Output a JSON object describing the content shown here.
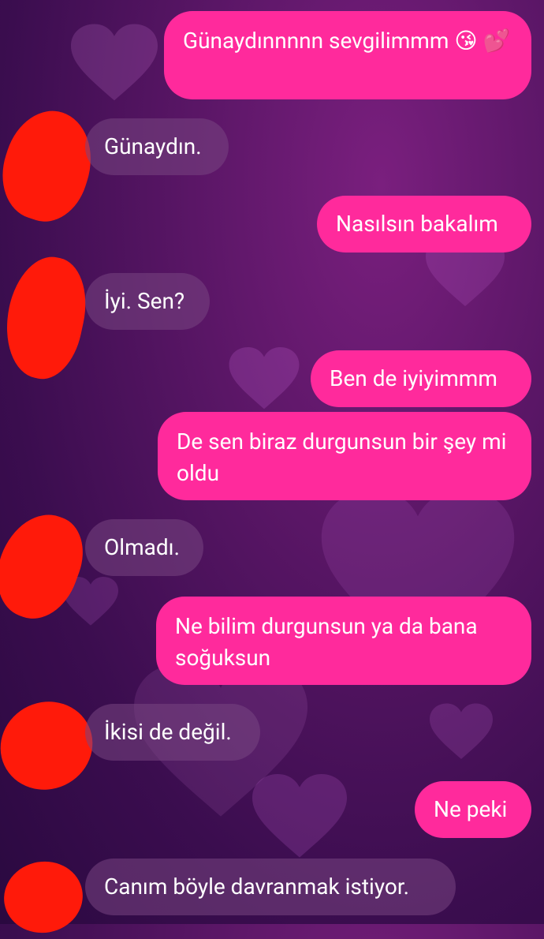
{
  "messages": [
    {
      "from": "me",
      "text": "Günaydınnnnn sevgilimmm 😘 💕"
    },
    {
      "from": "them",
      "text": "Günaydın."
    },
    {
      "from": "me",
      "text": "Nasılsın bakalım"
    },
    {
      "from": "them",
      "text": "İyi. Sen?"
    },
    {
      "from": "me",
      "text": "Ben de iyiyimmm"
    },
    {
      "from": "me",
      "text": "De sen biraz durgunsun bir şey mi oldu"
    },
    {
      "from": "them",
      "text": "Olmadı."
    },
    {
      "from": "me",
      "text": "Ne bilim durgunsun ya da bana soğuksun"
    },
    {
      "from": "them",
      "text": "İkisi de değil."
    },
    {
      "from": "me",
      "text": "Ne peki"
    },
    {
      "from": "them",
      "text": "Canım böyle davranmak istiyor."
    }
  ],
  "colors": {
    "outgoing_bubble": "#ff2a9c",
    "incoming_bubble": "#7a4682",
    "avatar_redaction": "#ff1a0a",
    "background": "#4a1060"
  }
}
